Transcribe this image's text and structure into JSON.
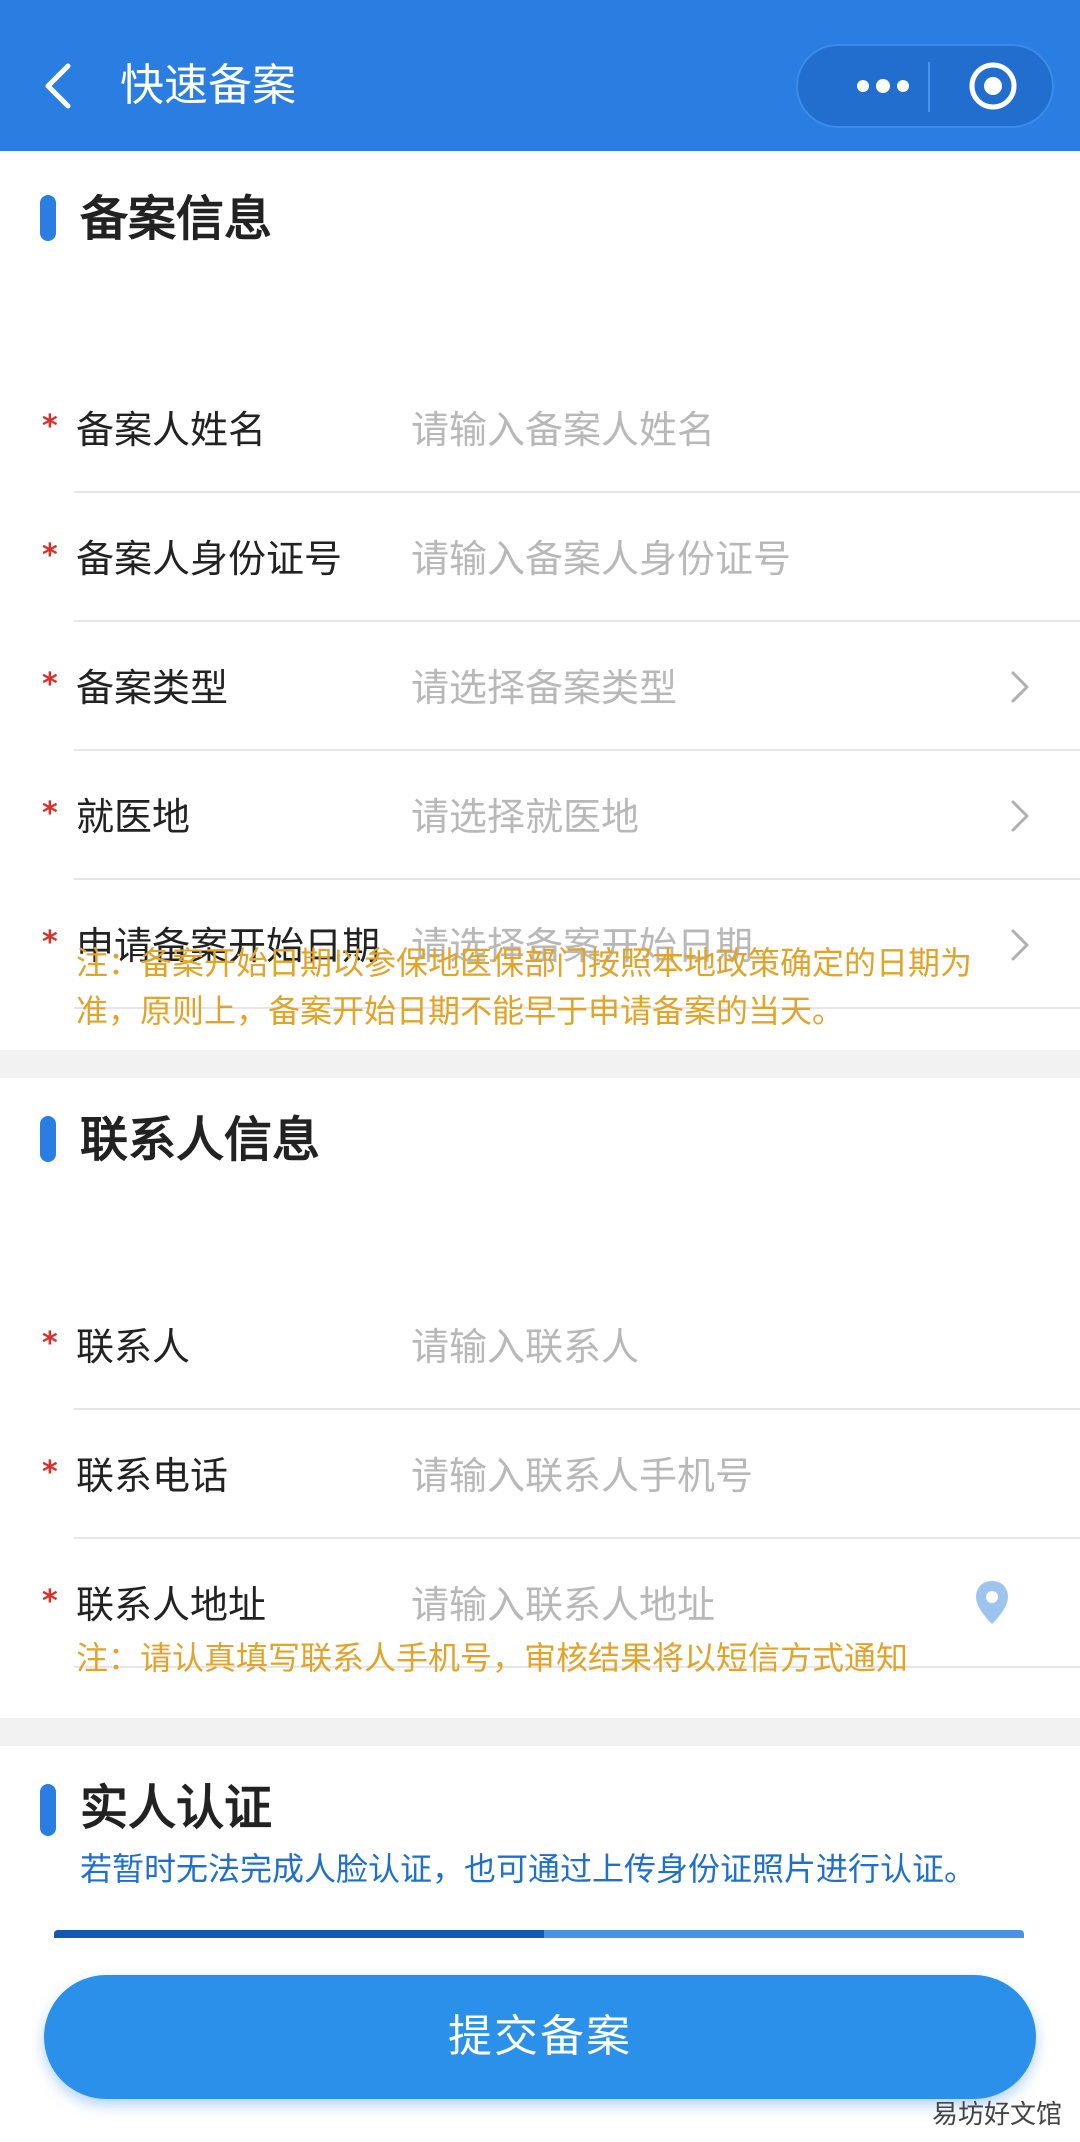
{
  "header": {
    "title": "快速备案",
    "accent": "#2a7de1"
  },
  "section1": {
    "title": "备案信息",
    "rows": [
      {
        "label": "备案人姓名",
        "placeholder": "请输入备案人姓名",
        "required_mark": "*"
      },
      {
        "label": "备案人身份证号",
        "placeholder": "请输入备案人身份证号",
        "required_mark": "*"
      },
      {
        "label": "备案类型",
        "placeholder": "请选择备案类型",
        "required_mark": "*",
        "icon": "chevron-right-icon"
      },
      {
        "label": "就医地",
        "placeholder": "请选择就医地",
        "required_mark": "*",
        "icon": "chevron-right-icon"
      },
      {
        "label": "申请备案开始日期",
        "placeholder": "请选择备案开始日期",
        "required_mark": "*",
        "icon": "chevron-right-icon"
      }
    ],
    "note_line1": "注：备案开始日期以参保地医保部门按照本地政策确定的日期为",
    "note_line2": "准，原则上，备案开始日期不能早于申请备案的当天。"
  },
  "section2": {
    "title": "联系人信息",
    "rows": [
      {
        "label": "联系人",
        "placeholder": "请输入联系人",
        "required_mark": "*"
      },
      {
        "label": "联系电话",
        "placeholder": "请输入联系人手机号",
        "required_mark": "*"
      },
      {
        "label": "联系人地址",
        "placeholder": "请输入联系人地址",
        "required_mark": "*",
        "icon": "location-pin-icon"
      }
    ],
    "note": "注：请认真填写联系人手机号，审核结果将以短信方式通知"
  },
  "section3": {
    "title": "实人认证",
    "subtitle": "若暂时无法完成人脸认证，也可通过上传身份证照片进行认证。"
  },
  "submit_label": "提交备案",
  "watermark": "易坊好文馆"
}
